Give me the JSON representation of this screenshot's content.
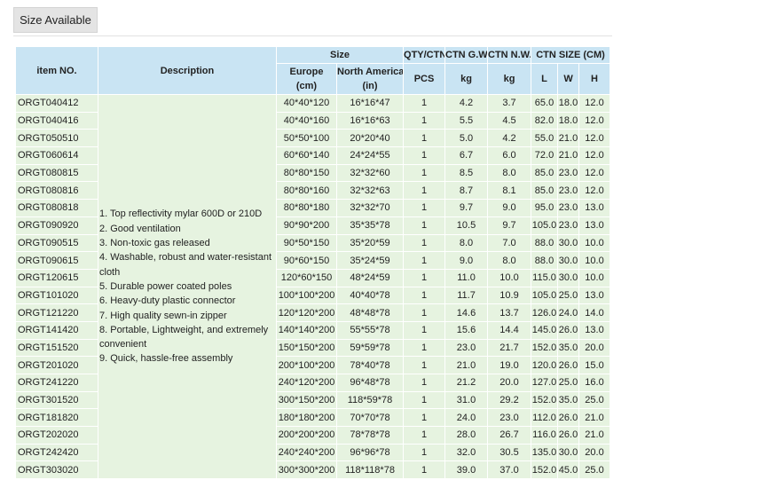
{
  "tab": {
    "label": "Size Available"
  },
  "headers": {
    "item": "item NO.",
    "description": "Description",
    "size": "Size",
    "europe": "Europe",
    "europe_unit": "(cm)",
    "na": "North America",
    "na_unit": "(in)",
    "qty": "QTY/CTN",
    "gw": "CTN G.W.",
    "nw": "CTN N.W.",
    "ctnsize": "CTN SIZE (CM)",
    "pcs": "PCS",
    "kg1": "kg",
    "kg2": "kg",
    "l": "L",
    "w": "W",
    "h": "H"
  },
  "description": [
    "1. Top reflectivity mylar 600D or 210D",
    "2. Good ventilation",
    "3. Non-toxic gas released",
    "4. Washable, robust and water-resistant cloth",
    "5. Durable power coated poles",
    "6. Heavy-duty plastic connector",
    "7. High quality sewn-in zipper",
    "8. Portable, Lightweight, and extremely convenient",
    "9. Quick, hassle-free assembly"
  ],
  "rows": [
    [
      "ORGT040412",
      "40*40*120",
      "16*16*47",
      "1",
      "4.2",
      "3.7",
      "65.0",
      "18.0",
      "12.0"
    ],
    [
      "ORGT040416",
      "40*40*160",
      "16*16*63",
      "1",
      "5.5",
      "4.5",
      "82.0",
      "18.0",
      "12.0"
    ],
    [
      "ORGT050510",
      "50*50*100",
      "20*20*40",
      "1",
      "5.0",
      "4.2",
      "55.0",
      "21.0",
      "12.0"
    ],
    [
      "ORGT060614",
      "60*60*140",
      "24*24*55",
      "1",
      "6.7",
      "6.0",
      "72.0",
      "21.0",
      "12.0"
    ],
    [
      "ORGT080815",
      "80*80*150",
      "32*32*60",
      "1",
      "8.5",
      "8.0",
      "85.0",
      "23.0",
      "12.0"
    ],
    [
      "ORGT080816",
      "80*80*160",
      "32*32*63",
      "1",
      "8.7",
      "8.1",
      "85.0",
      "23.0",
      "12.0"
    ],
    [
      "ORGT080818",
      "80*80*180",
      "32*32*70",
      "1",
      "9.7",
      "9.0",
      "95.0",
      "23.0",
      "13.0"
    ],
    [
      "ORGT090920",
      "90*90*200",
      "35*35*78",
      "1",
      "10.5",
      "9.7",
      "105.0",
      "23.0",
      "13.0"
    ],
    [
      "ORGT090515",
      "90*50*150",
      "35*20*59",
      "1",
      "8.0",
      "7.0",
      "88.0",
      "30.0",
      "10.0"
    ],
    [
      "ORGT090615",
      "90*60*150",
      "35*24*59",
      "1",
      "9.0",
      "8.0",
      "88.0",
      "30.0",
      "10.0"
    ],
    [
      "ORGT120615",
      "120*60*150",
      "48*24*59",
      "1",
      "11.0",
      "10.0",
      "115.0",
      "30.0",
      "10.0"
    ],
    [
      "ORGT101020",
      "100*100*200",
      "40*40*78",
      "1",
      "11.7",
      "10.9",
      "105.0",
      "25.0",
      "13.0"
    ],
    [
      "ORGT121220",
      "120*120*200",
      "48*48*78",
      "1",
      "14.6",
      "13.7",
      "126.0",
      "24.0",
      "14.0"
    ],
    [
      "ORGT141420",
      "140*140*200",
      "55*55*78",
      "1",
      "15.6",
      "14.4",
      "145.0",
      "26.0",
      "13.0"
    ],
    [
      "ORGT151520",
      "150*150*200",
      "59*59*78",
      "1",
      "23.0",
      "21.7",
      "152.0",
      "35.0",
      "20.0"
    ],
    [
      "ORGT201020",
      "200*100*200",
      "78*40*78",
      "1",
      "21.0",
      "19.0",
      "120.0",
      "26.0",
      "15.0"
    ],
    [
      "ORGT241220",
      "240*120*200",
      "96*48*78",
      "1",
      "21.2",
      "20.0",
      "127.0",
      "25.0",
      "16.0"
    ],
    [
      "ORGT301520",
      "300*150*200",
      "118*59*78",
      "1",
      "31.0",
      "29.2",
      "152.0",
      "35.0",
      "25.0"
    ],
    [
      "ORGT181820",
      "180*180*200",
      "70*70*78",
      "1",
      "24.0",
      "23.0",
      "112.0",
      "26.0",
      "21.0"
    ],
    [
      "ORGT202020",
      "200*200*200",
      "78*78*78",
      "1",
      "28.0",
      "26.7",
      "116.0",
      "26.0",
      "21.0"
    ],
    [
      "ORGT242420",
      "240*240*200",
      "96*96*78",
      "1",
      "32.0",
      "30.5",
      "135.0",
      "30.0",
      "20.0"
    ],
    [
      "ORGT303020",
      "300*300*200",
      "118*118*78",
      "1",
      "39.0",
      "37.0",
      "152.0",
      "45.0",
      "25.0"
    ]
  ]
}
